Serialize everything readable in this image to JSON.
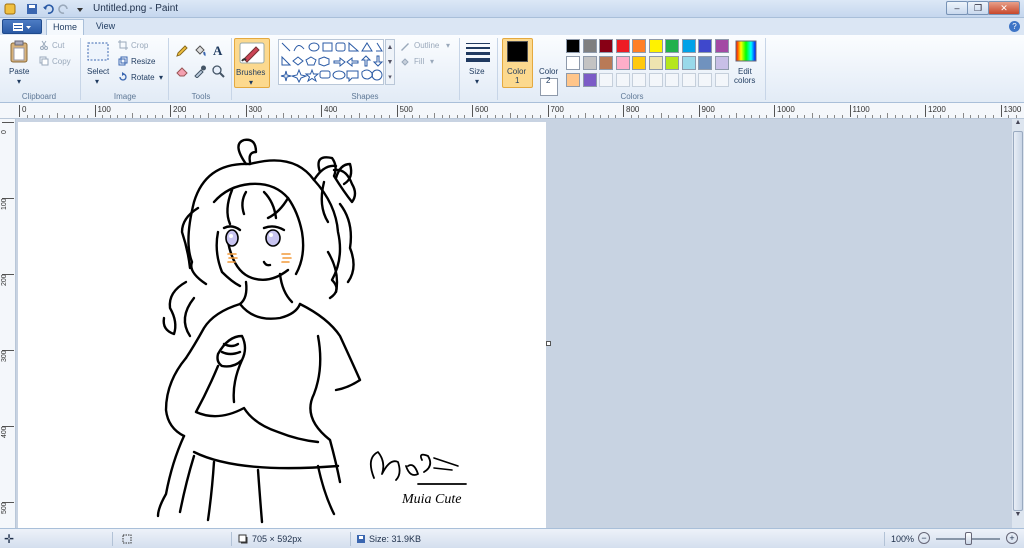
{
  "app": {
    "title": "Untitled.png - Paint"
  },
  "window": {
    "minimize": "–",
    "restore": "❐",
    "close": "✕"
  },
  "tabs": {
    "home": "Home",
    "view": "View"
  },
  "clipboard": {
    "paste": "Paste",
    "cut": "Cut",
    "copy": "Copy",
    "group": "Clipboard"
  },
  "image": {
    "select": "Select",
    "crop": "Crop",
    "resize": "Resize",
    "rotate": "Rotate",
    "group": "Image"
  },
  "tools": {
    "group": "Tools"
  },
  "brushes": {
    "label": "Brushes"
  },
  "shapes": {
    "outline": "Outline",
    "fill": "Fill",
    "group": "Shapes"
  },
  "size": {
    "label": "Size"
  },
  "colors": {
    "color1": "Color",
    "color1_num": "1",
    "color2": "Color",
    "color2_num": "2",
    "edit": "Edit",
    "edit2": "colors",
    "group": "Colors",
    "color1_value": "#000000",
    "color2_value": "#ffffff",
    "palette": [
      "#000000",
      "#7f7f7f",
      "#880015",
      "#ed1c24",
      "#ff7f27",
      "#fff200",
      "#22b14c",
      "#00a2e8",
      "#3f48cc",
      "#a349a4",
      "#ffffff",
      "#c3c3c3",
      "#b97a57",
      "#ffaec9",
      "#ffc90e",
      "#efe4b0",
      "#b5e61d",
      "#99d9ea",
      "#7092be",
      "#c8bfe7",
      "#ffc58a",
      "#7c5cc7",
      "",
      "",
      "",
      "",
      "",
      "",
      "",
      ""
    ]
  },
  "ruler": {
    "h": [
      "0",
      "100",
      "200",
      "300",
      "400",
      "500",
      "600",
      "700",
      "800",
      "900",
      "1000",
      "1100",
      "1200",
      "1300"
    ],
    "v": [
      "0",
      "100",
      "200",
      "300",
      "400",
      "500"
    ]
  },
  "drawing": {
    "signature_text": "Muia Cute",
    "signature_initial": "Mua"
  },
  "status": {
    "dimensions": "705 × 592px",
    "size": "Size: 31.9KB",
    "zoom": "100%",
    "zoom_out": "−",
    "zoom_in": "+"
  }
}
